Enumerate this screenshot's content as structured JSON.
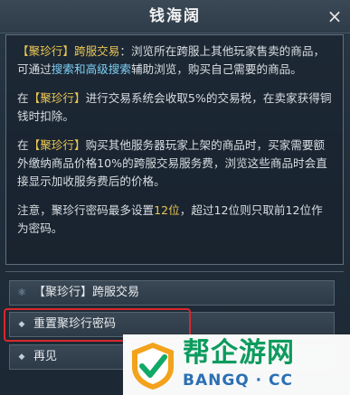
{
  "window": {
    "title": "钱海阔",
    "close_label": "×"
  },
  "info": {
    "p1": {
      "a": "【聚珍行】跨服交易",
      "b": "：浏览所在跨服上其他玩家售卖的商品，可通过",
      "c": "搜索和高级搜索",
      "d": "辅助浏览，购买自己需要的商品。"
    },
    "p2": {
      "a": "在",
      "b": "【聚珍行】",
      "c": "进行交易系统会收取5%的交易税，在卖家获得铜钱时扣除。"
    },
    "p3": {
      "a": "在",
      "b": "【聚珍行】",
      "c": "购买其他服务器玩家上架的商品时，买家需要额外缴纳商品价格10%的跨服交易服务费，浏览这些商品时会直接显示加收服务费后的价格。"
    },
    "p4": {
      "a": "注意，聚珍行密码最多设置",
      "b": "12位",
      "c": "，超过12位则只取前12位作为密码。"
    }
  },
  "options": [
    {
      "icon": "money-bag-icon",
      "label": "【聚珍行】跨服交易"
    },
    {
      "icon": "diamond-bullet-icon",
      "label": "重置聚珍行密码"
    },
    {
      "icon": "diamond-bullet-icon",
      "label": "再见"
    }
  ],
  "watermark": {
    "text": "帮企游网",
    "sub": "BANGQ · CC"
  }
}
